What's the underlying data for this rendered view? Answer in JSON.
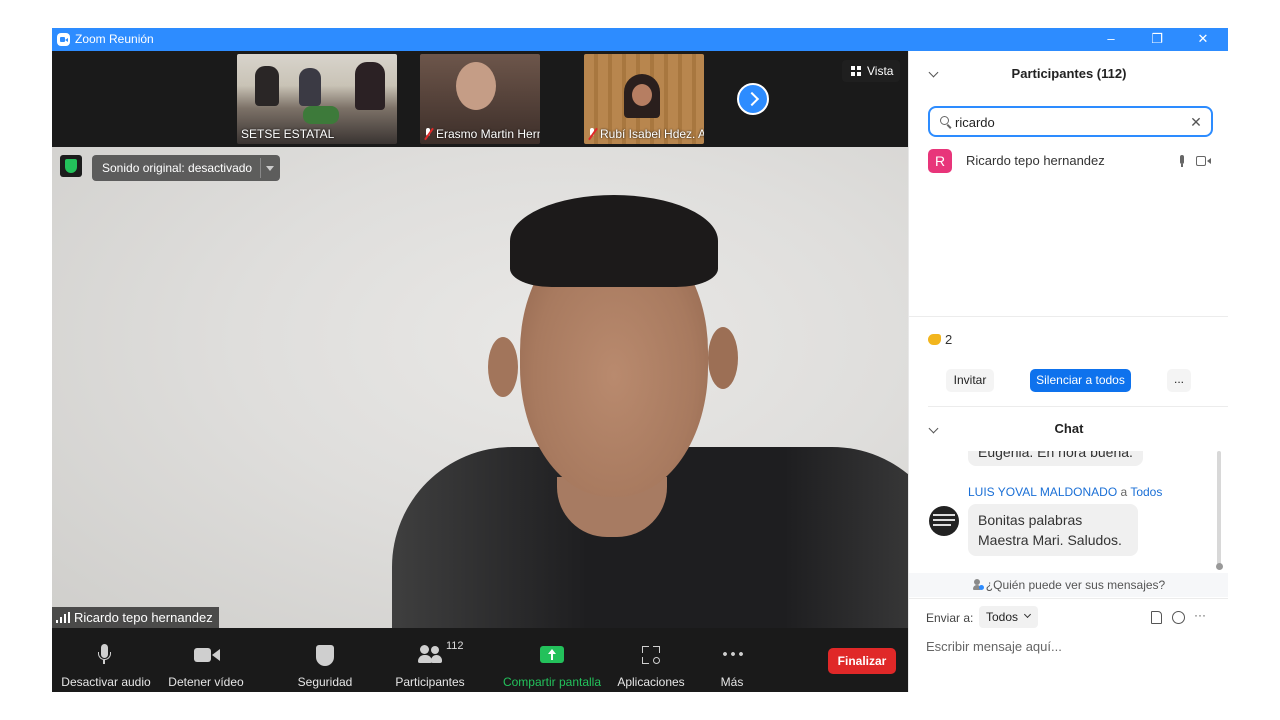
{
  "window": {
    "title": "Zoom Reunión",
    "controls": {
      "minimize": "–",
      "restore": "❐",
      "close": "✕"
    }
  },
  "strip": {
    "thumbnails": [
      {
        "name": "SETSE ESTATAL",
        "muted": false
      },
      {
        "name": "Erasmo Martin Herná...",
        "muted": true
      },
      {
        "name": "Rubí Isabel Hdez. Ale...",
        "muted": true
      }
    ],
    "view_label": "Vista"
  },
  "main_video": {
    "audio_pill": "Sonido original: desactivado",
    "speaker": "Ricardo tepo hernandez"
  },
  "toolbar": {
    "mute_audio": "Desactivar audio",
    "stop_video": "Detener vídeo",
    "security": "Seguridad",
    "participants": "Participantes",
    "participants_count": "112",
    "share_screen": "Compartir pantalla",
    "apps": "Aplicaciones",
    "more": "Más",
    "end": "Finalizar"
  },
  "participants_panel": {
    "title": "Participantes (112)",
    "search_value": "ricardo",
    "clear_icon": "✕",
    "results": [
      {
        "initial": "R",
        "name": "Ricardo tepo hernandez"
      }
    ],
    "reaction_count": "2",
    "invite": "Invitar",
    "mute_all": "Silenciar a todos",
    "more": "..."
  },
  "chat": {
    "title": "Chat",
    "partial_message": "Eugenia. En hora buena.",
    "sender": "LUIS YOVAL MALDONADO",
    "recipient_prefix": "a",
    "recipient": "Todos",
    "message_line1": "Bonitas palabras",
    "message_line2": "Maestra Mari. Saludos.",
    "who_can_see": "¿Quién puede ver sus mensajes?",
    "send_to_label": "Enviar a:",
    "send_to_value": "Todos",
    "input_placeholder": "Escribir mensaje aquí...",
    "more_icon": "···"
  },
  "colors": {
    "accent": "#2d8cff",
    "end_red": "#e02828",
    "share_green": "#23c15b",
    "avatar_pink": "#e8357a"
  }
}
